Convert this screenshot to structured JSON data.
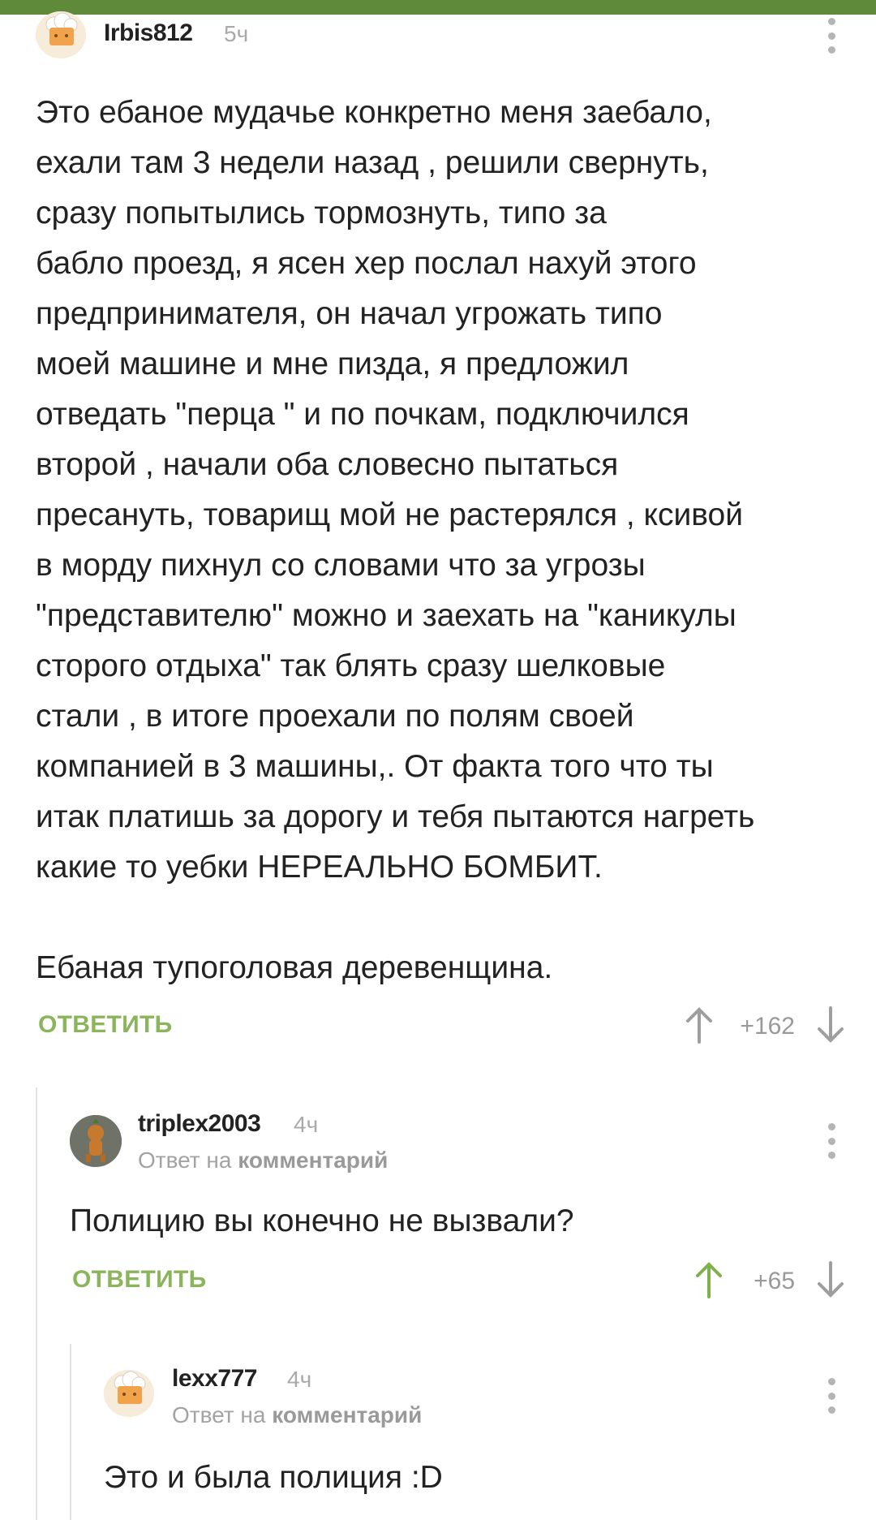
{
  "comments": [
    {
      "username": "Irbis812",
      "time": "5ч",
      "paragraphs": [
        "Это ебаное мудачье конкретно меня заебало,\nехали там 3 недели назад , решили свернуть,\nсразу попытылись тормознуть, типо за\nбабло проезд, я ясен хер послал нахуй этого\nпредпринимателя, он начал угрожать типо\nмоей машине и мне пизда, я предложил\nотведать \"перца \" и по почкам, подключился\nвторой , начали оба словесно пытаться\nпресануть, товарищ мой не растерялся , ксивой\nв морду пихнул со словами что за угрозы\n\"представителю\" можно и заехать на \"каникулы\nсторого отдыха\" так блять сразу шелковые\nстали , в итоге проехали по полям своей\nкомпанией в 3 машины,. От факта того что ты\nитак платишь за дорогу и тебя пытаются нагреть\nкакие то уебки НЕРЕАЛЬНО БОМБИТ.",
        "Ебаная тупоголовая деревенщина."
      ],
      "reply_label": "ОТВЕТИТЬ",
      "rating": "+162",
      "voted_up": false
    },
    {
      "username": "triplex2003",
      "time": "4ч",
      "reply_prefix": "Ответ на",
      "reply_target": "комментарий",
      "paragraphs": [
        "Полицию вы конечно не вызвали?"
      ],
      "reply_label": "ОТВЕТИТЬ",
      "rating": "+65",
      "voted_up": true
    },
    {
      "username": "lexx777",
      "time": "4ч",
      "reply_prefix": "Ответ на",
      "reply_target": "комментарий",
      "paragraphs": [
        "Это и была полиция :D"
      ]
    }
  ],
  "colors": {
    "accent_green": "#8ab55a",
    "top_bar": "#5e8a3a",
    "muted_text": "#a9a9a9"
  },
  "icons": {
    "menu": "vertical-dots-icon",
    "upvote": "arrow-up-icon",
    "downvote": "arrow-down-icon",
    "default_avatar": "chef-hat-avatar-icon"
  }
}
